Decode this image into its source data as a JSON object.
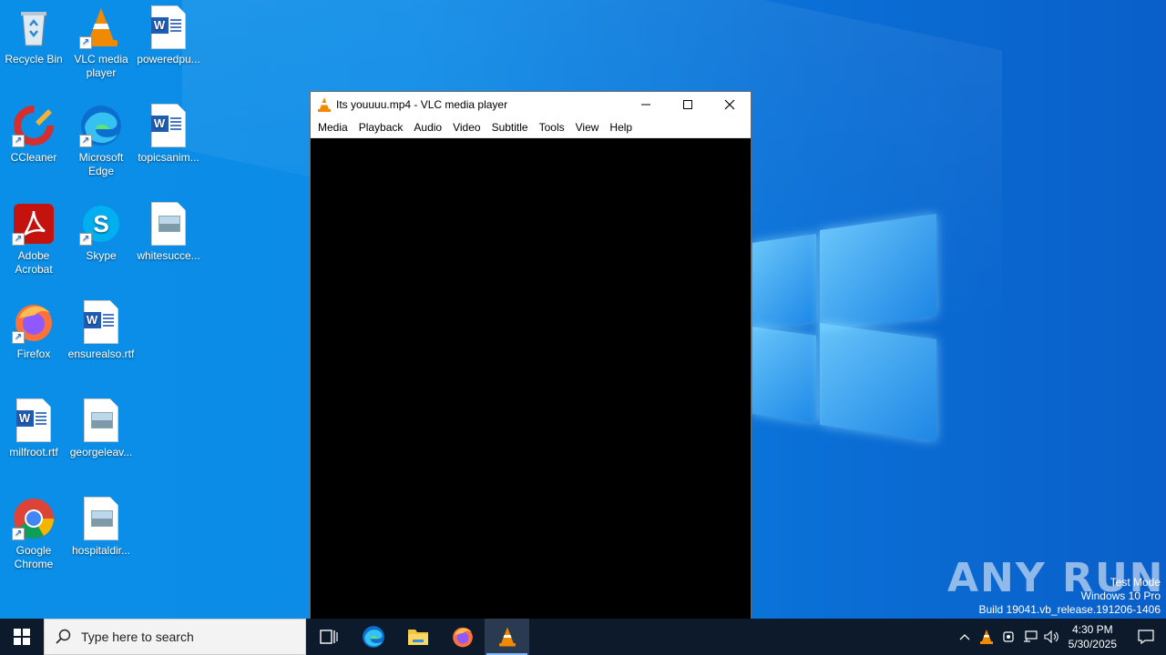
{
  "desktop": {
    "icons": [
      {
        "label": "Recycle Bin"
      },
      {
        "label": "VLC media player"
      },
      {
        "label": "poweredpu..."
      },
      {
        "label": "CCleaner"
      },
      {
        "label": "Microsoft Edge"
      },
      {
        "label": "topicsanim..."
      },
      {
        "label": "Adobe Acrobat"
      },
      {
        "label": "Skype"
      },
      {
        "label": "whitesucce..."
      },
      {
        "label": "Firefox"
      },
      {
        "label": "ensurealso.rtf"
      },
      {
        "label": "milfroot.rtf"
      },
      {
        "label": "georgeleav..."
      },
      {
        "label": "Google Chrome"
      },
      {
        "label": "hospitaldir..."
      }
    ]
  },
  "vlc": {
    "title": "Its youuuu.mp4 - VLC media player",
    "menu": [
      "Media",
      "Playback",
      "Audio",
      "Video",
      "Subtitle",
      "Tools",
      "View",
      "Help"
    ]
  },
  "watermark": {
    "line1": "Test Mode",
    "line2": "Windows 10 Pro",
    "line3": "Build 19041.vb_release.191206-1406",
    "brand": "ANY RUN"
  },
  "taskbar": {
    "search_placeholder": "Type here to search",
    "time": "4:30 PM",
    "date": "5/30/2025"
  },
  "colors": {
    "desktop_blue": "#0a8fe8",
    "taskbar": "#0c1a2c",
    "vlc_orange": "#f18a00"
  }
}
